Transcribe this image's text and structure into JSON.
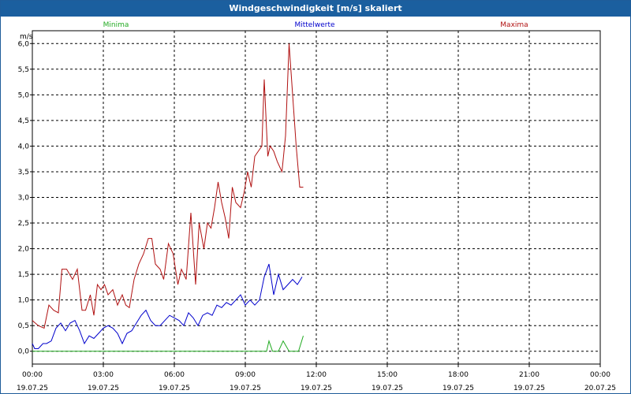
{
  "window": {
    "title": "Windgeschwindigkeit [m/s] skaliert"
  },
  "chart_data": {
    "type": "line",
    "title": "Windgeschwindigkeit [m/s] skaliert",
    "ylabel": "m/s",
    "xlabel": "",
    "ylim": [
      -0.25,
      6.25
    ],
    "xlim": [
      0,
      24
    ],
    "grid": true,
    "legend_placement": "top",
    "y_ticks": [
      "0,0",
      "0,5",
      "1,0",
      "1,5",
      "2,0",
      "2,5",
      "3,0",
      "3,5",
      "4,0",
      "4,5",
      "5,0",
      "5,5",
      "6,0"
    ],
    "x_ticks": [
      {
        "time": "00:00",
        "date": "19.07.25"
      },
      {
        "time": "03:00",
        "date": "19.07.25"
      },
      {
        "time": "06:00",
        "date": "19.07.25"
      },
      {
        "time": "09:00",
        "date": "19.07.25"
      },
      {
        "time": "12:00",
        "date": "19.07.25"
      },
      {
        "time": "15:00",
        "date": "19.07.25"
      },
      {
        "time": "18:00",
        "date": "19.07.25"
      },
      {
        "time": "21:00",
        "date": "19.07.25"
      },
      {
        "time": "00:00",
        "date": "20.07.25"
      }
    ],
    "series": [
      {
        "name": "Minima",
        "color": "#22aa22",
        "x": [
          0.0,
          9.9,
          10.0,
          10.15,
          10.4,
          10.6,
          10.85,
          11.05,
          11.25,
          11.45
        ],
        "values": [
          0.0,
          0.0,
          0.2,
          0.0,
          0.0,
          0.2,
          0.0,
          0.0,
          0.0,
          0.3
        ]
      },
      {
        "name": "Mittelwerte",
        "color": "#0000cc",
        "x": [
          0.0,
          0.1,
          0.25,
          0.45,
          0.6,
          0.8,
          1.0,
          1.2,
          1.4,
          1.6,
          1.8,
          2.0,
          2.2,
          2.4,
          2.6,
          2.8,
          3.0,
          3.2,
          3.4,
          3.6,
          3.8,
          4.0,
          4.2,
          4.4,
          4.6,
          4.8,
          5.0,
          5.2,
          5.4,
          5.6,
          5.8,
          6.0,
          6.2,
          6.4,
          6.6,
          6.8,
          7.0,
          7.2,
          7.4,
          7.6,
          7.8,
          8.0,
          8.2,
          8.4,
          8.6,
          8.8,
          9.0,
          9.2,
          9.4,
          9.6,
          9.8,
          10.0,
          10.2,
          10.4,
          10.6,
          10.8,
          11.0,
          11.2,
          11.4
        ],
        "values": [
          0.15,
          0.05,
          0.05,
          0.15,
          0.15,
          0.2,
          0.45,
          0.55,
          0.4,
          0.55,
          0.6,
          0.4,
          0.15,
          0.3,
          0.25,
          0.35,
          0.45,
          0.5,
          0.45,
          0.35,
          0.15,
          0.35,
          0.4,
          0.55,
          0.7,
          0.8,
          0.6,
          0.5,
          0.5,
          0.6,
          0.7,
          0.65,
          0.6,
          0.5,
          0.75,
          0.65,
          0.5,
          0.7,
          0.75,
          0.7,
          0.9,
          0.85,
          0.95,
          0.9,
          1.0,
          1.1,
          0.9,
          1.0,
          0.9,
          1.0,
          1.45,
          1.7,
          1.1,
          1.5,
          1.2,
          1.3,
          1.4,
          1.3,
          1.45
        ]
      },
      {
        "name": "Maxima",
        "color": "#b01010",
        "x": [
          0.0,
          0.25,
          0.5,
          0.7,
          0.9,
          1.1,
          1.25,
          1.45,
          1.7,
          1.9,
          2.1,
          2.25,
          2.45,
          2.6,
          2.75,
          2.9,
          3.05,
          3.2,
          3.4,
          3.6,
          3.8,
          3.95,
          4.1,
          4.3,
          4.5,
          4.7,
          4.9,
          5.05,
          5.2,
          5.4,
          5.55,
          5.75,
          5.95,
          6.15,
          6.3,
          6.5,
          6.7,
          6.9,
          7.05,
          7.25,
          7.4,
          7.55,
          7.7,
          7.85,
          8.0,
          8.15,
          8.3,
          8.45,
          8.6,
          8.8,
          8.95,
          9.1,
          9.25,
          9.4,
          9.55,
          9.7,
          9.8,
          9.95,
          10.05,
          10.2,
          10.35,
          10.55,
          10.7,
          10.85,
          11.0,
          11.15,
          11.3,
          11.45
        ],
        "values": [
          0.6,
          0.5,
          0.45,
          0.9,
          0.8,
          0.75,
          1.6,
          1.6,
          1.4,
          1.6,
          0.8,
          0.8,
          1.1,
          0.7,
          1.3,
          1.2,
          1.3,
          1.1,
          1.2,
          0.9,
          1.1,
          0.9,
          0.85,
          1.4,
          1.7,
          1.9,
          2.2,
          2.2,
          1.7,
          1.6,
          1.4,
          2.1,
          1.9,
          1.3,
          1.6,
          1.4,
          2.7,
          1.3,
          2.5,
          2.0,
          2.5,
          2.4,
          2.8,
          3.3,
          2.9,
          2.6,
          2.2,
          3.2,
          2.9,
          2.8,
          3.1,
          3.5,
          3.2,
          3.8,
          3.9,
          4.0,
          5.3,
          3.8,
          4.0,
          3.9,
          3.7,
          3.5,
          4.2,
          6.0,
          5.0,
          4.0,
          3.2,
          3.2
        ]
      }
    ]
  }
}
